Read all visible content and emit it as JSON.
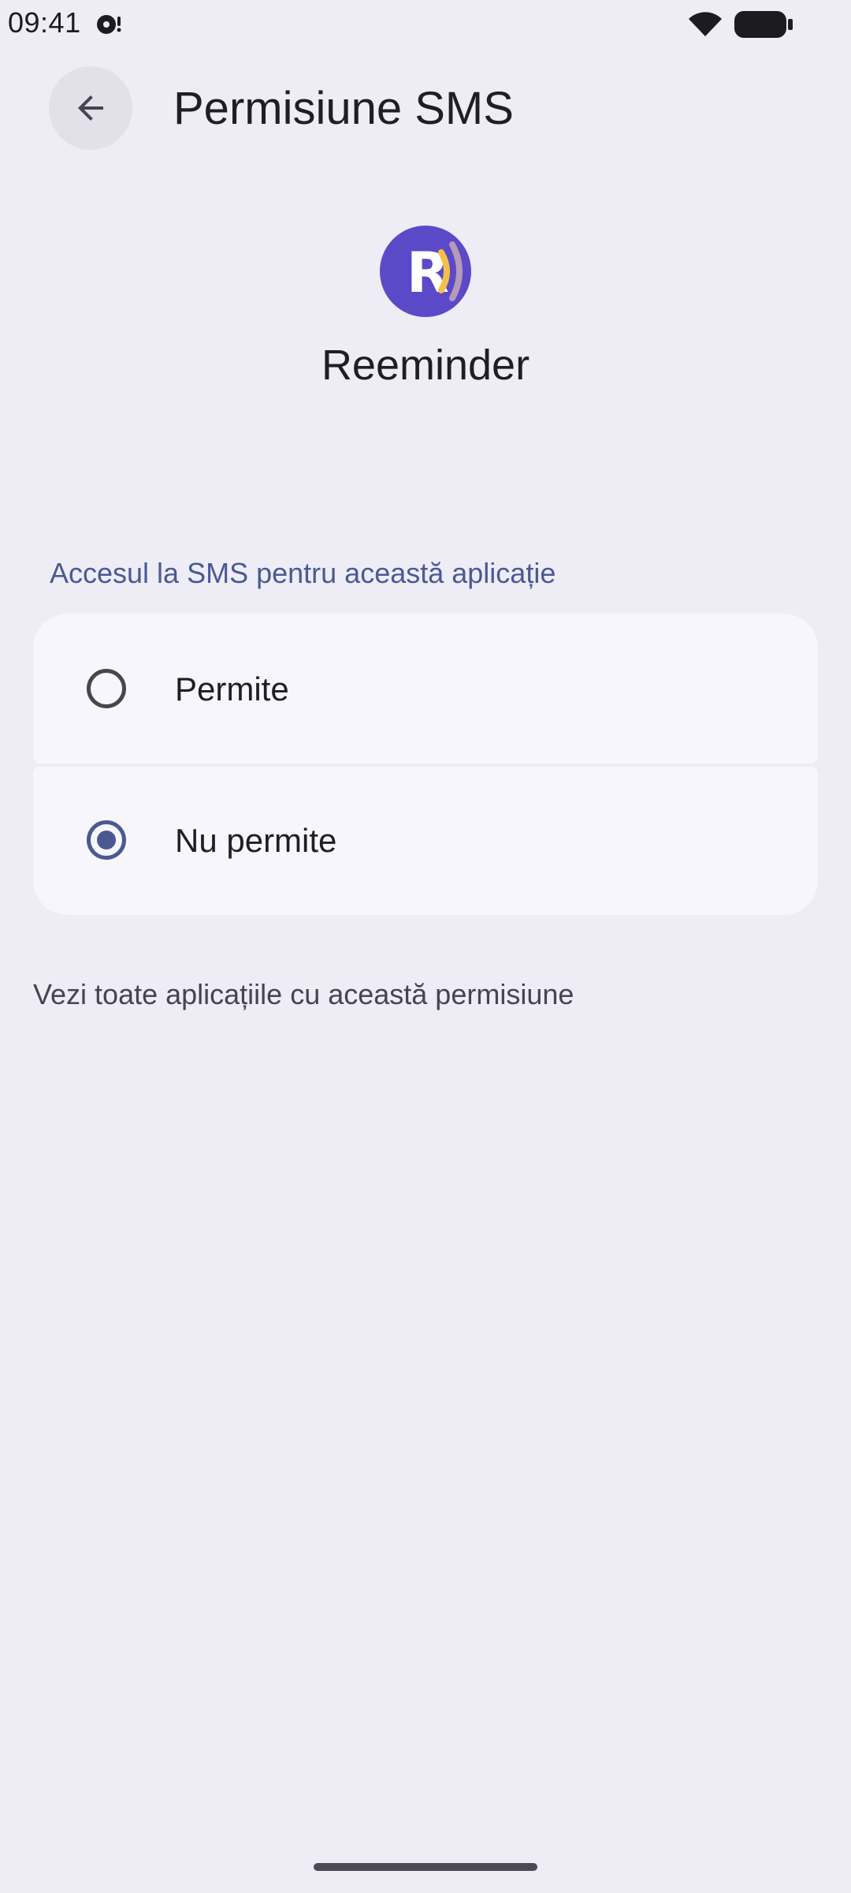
{
  "status_bar": {
    "time": "09:41",
    "left_icon": "notification-icon",
    "wifi_icon": "wifi-icon",
    "battery_icon": "battery-icon"
  },
  "app_bar": {
    "back_icon": "arrow-back-icon",
    "title": "Permisiune SMS"
  },
  "app": {
    "name": "Reeminder",
    "icon": "reeminder-app-icon",
    "icon_letter": "R",
    "colors": {
      "icon_bg": "#5b4ac8",
      "icon_arc_1": "#f5c04a",
      "icon_arc_2": "#b79ab8"
    }
  },
  "permission": {
    "section_label": "Accesul la SMS pentru această aplicație",
    "options": [
      {
        "label": "Permite",
        "selected": false
      },
      {
        "label": "Nu permite",
        "selected": true
      }
    ]
  },
  "footer_link": "Vezi toate aplicațiile cu această permisiune",
  "colors": {
    "background": "#eeecf5",
    "card": "#f8f6fd",
    "accent": "#4a5a91",
    "text_primary": "#1f1e25",
    "text_secondary": "#46454f"
  }
}
